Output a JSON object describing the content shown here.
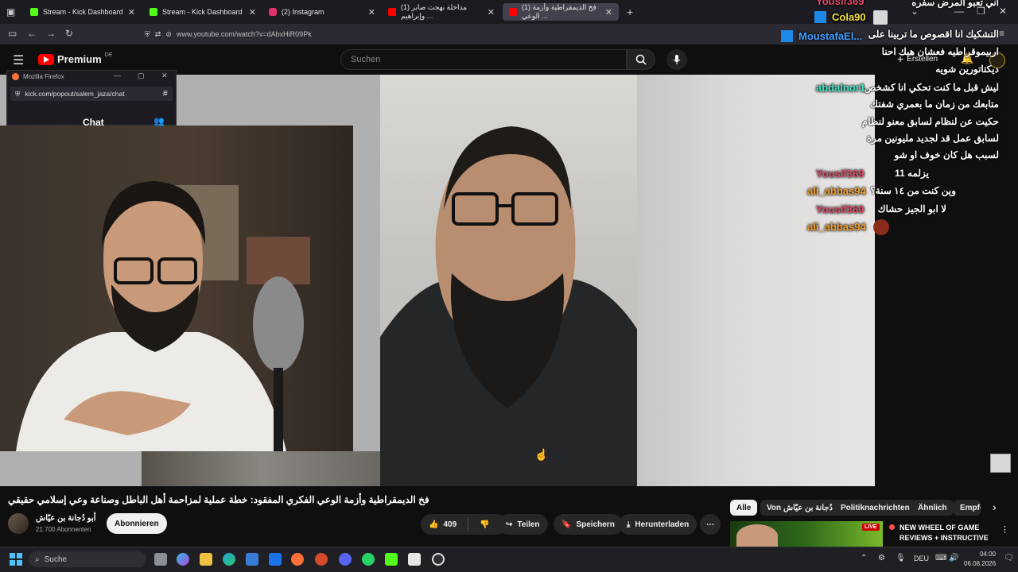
{
  "browser": {
    "tabs": [
      {
        "label": "Stream - Kick Dashboard",
        "favicon": "#53fc18"
      },
      {
        "label": "Stream - Kick Dashboard",
        "favicon": "#53fc18"
      },
      {
        "label": "(2) Instagram",
        "favicon": "#e1306c"
      },
      {
        "label": "(1) مداخلة بهجت صابر وإبراهيم ...",
        "favicon": "#ff0000"
      },
      {
        "label": "(1) فخ الديمقراطية وأزمة الوعي ...",
        "favicon": "#ff0000"
      }
    ],
    "url": "www.youtube.com/watch?v=dAbxHiR09Pk"
  },
  "youtube": {
    "logo": "Premium",
    "logo_region": "DE",
    "search_placeholder": "Suchen",
    "create_label": "Erstellen"
  },
  "popout": {
    "title": "Mozilla Firefox",
    "url": "kick.com/popout/salem_jaza/chat",
    "chat_label": "Chat"
  },
  "chat_overlay": [
    {
      "name": "Yousif369",
      "color": "#e04a6a"
    },
    {
      "name": "Cola90",
      "color": "#f0e040"
    },
    {
      "name": "MoustafaEl...",
      "color": "#40a0ff"
    },
    {
      "name": "abdalnor1",
      "color": "#40e0c0"
    },
    {
      "name": "Yousif369",
      "color": "#e04a6a"
    },
    {
      "name": "ali_abbas94",
      "color": "#f0a030"
    },
    {
      "name": "Yousif369",
      "color": "#e04a6a"
    },
    {
      "name": "ali_abbas94",
      "color": "#f0a030"
    }
  ],
  "chat_messages": [
    "اني تعبو المرض سفره",
    "التشكيك انا اقصوص ما تربينا على",
    "اربيموقراطيه فعشان هيك احنا",
    "ديكتاتورين شويه",
    "ليش قبل ما كنت تحكي انا كشخص",
    "متابعك من زمان ما بعمري شفتك",
    "حكيت عن لنظام لسابق معنو لنظام",
    "لسابق عمل قد لجديد مليونين مرة",
    "لسبب هل كان خوف او شو",
    "يزلمه 11",
    "وين كنت من ١٤ سنة؟",
    "لا ابو الجيز حشاك"
  ],
  "video": {
    "title": "فخ الديمقراطية وأزمة الوعي الفكري المفقود: خطة عملية لمزاحمة أهل الباطل وصناعة وعي إسلامي حقيقي",
    "channel_name": "أبو دُجانة بن عيّاش",
    "subscribers": "21.700 Abonnenten",
    "subscribe_label": "Abonnieren",
    "likes": "409",
    "share_label": "Teilen",
    "save_label": "Speichern",
    "download_label": "Herunterladen"
  },
  "chips": [
    "Alle",
    "Von أبو دُجانة بن عيّاش",
    "Politiknachrichten",
    "Ähnlich",
    "Empfe"
  ],
  "recommendation": {
    "badge": "LIVE",
    "title": "NEW WHEEL OF GAME REVIEWS + INSTRUCTIVE ..."
  },
  "taskbar": {
    "search_placeholder": "Suche",
    "lang": "DEU",
    "time": "04:00",
    "date": "06.08.2026"
  }
}
